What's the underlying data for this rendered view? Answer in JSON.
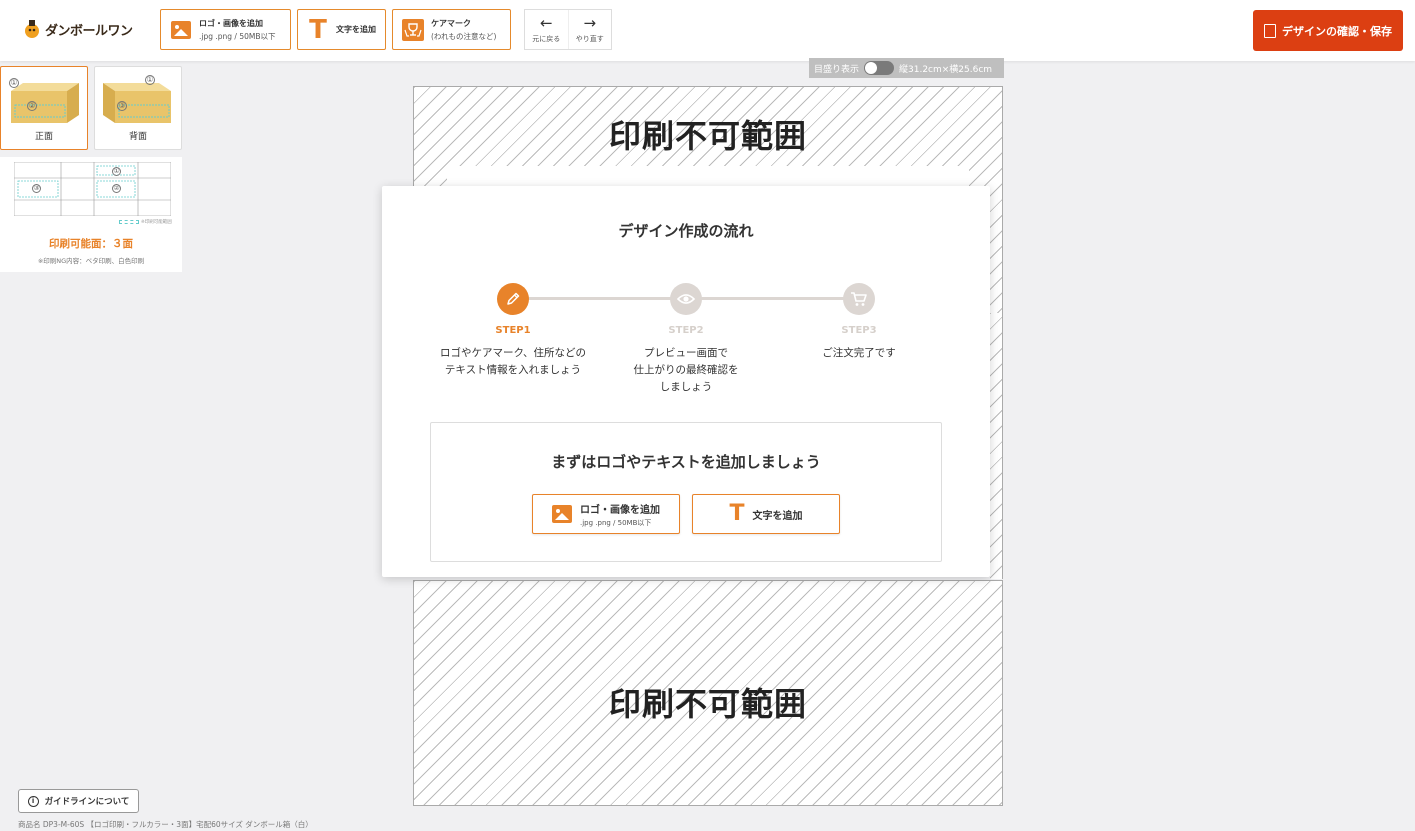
{
  "header": {
    "logo_text": "ダンボールワン",
    "add_logo": {
      "label": "ロゴ・画像を追加",
      "sub": ".jpg .png / 50MB以下"
    },
    "add_text": {
      "label": "文字を追加"
    },
    "care_mark": {
      "label": "ケアマーク",
      "sub": "(われもの注意など)"
    },
    "undo": {
      "label": "元に戻る",
      "icon": "arrow-left-icon"
    },
    "redo": {
      "label": "やり直す",
      "icon": "arrow-right-icon"
    },
    "save_label": "デザインの確認・保存",
    "accent_color": "#e8832a",
    "save_color": "#dc3f12"
  },
  "faces": [
    {
      "label": "正面",
      "active": true,
      "markers": [
        "①",
        "②"
      ]
    },
    {
      "label": "背面",
      "active": false,
      "markers": [
        "①",
        "③"
      ]
    }
  ],
  "diagram": {
    "markers": [
      "①",
      "③",
      "②"
    ],
    "legend": "※印刷可能範囲",
    "printable": "印刷可能面：３面",
    "ng_note": "※印刷NG内容：ベタ印刷、白色印刷"
  },
  "canvas": {
    "scale_label": "目盛り表示",
    "dimensions": "縦31.2cm×横25.6cm",
    "no_print_top": "印刷不可範囲",
    "no_print_bottom": "印刷不可範囲"
  },
  "modal": {
    "title": "デザイン作成の流れ",
    "steps": [
      {
        "name": "STEP1",
        "desc": "ロゴやケアマーク、住所などの\nテキスト情報を入れましょう",
        "icon": "pencil-icon",
        "active": true
      },
      {
        "name": "STEP2",
        "desc": "プレビュー画面で\n仕上がりの最終確認を\nしましょう",
        "icon": "eye-icon",
        "active": false
      },
      {
        "name": "STEP3",
        "desc": "ご注文完了です",
        "icon": "cart-icon",
        "active": false
      }
    ],
    "cta_title": "まずはロゴやテキストを追加しましょう",
    "cta_logo": {
      "label": "ロゴ・画像を追加",
      "sub": ".jpg .png / 50MB以下"
    },
    "cta_text": {
      "label": "文字を追加"
    }
  },
  "footer": {
    "guide_label": "ガイドラインについて",
    "product_name": "商品名 DP3-M-60S 【ロゴ印刷・フルカラー・3面】宅配60サイズ ダンボール箱（白）"
  }
}
